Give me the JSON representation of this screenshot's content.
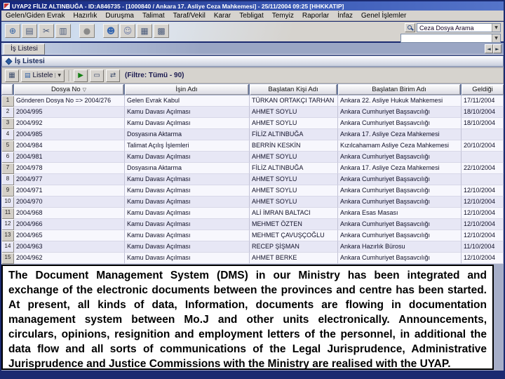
{
  "window": {
    "title": "UYAP2  FİLİZ ALTINBUĞA - ID:A846735 - [1000840 / Ankara 17. Asliye Ceza Mahkemesi] - 25/11/2004 09:25 [HHKKATIP]"
  },
  "menu": {
    "items": [
      {
        "label": "Gelen/Giden Evrak"
      },
      {
        "label": "Hazırlık"
      },
      {
        "label": "Duruşma"
      },
      {
        "label": "Talimat"
      },
      {
        "label": "Taraf/Vekil"
      },
      {
        "label": "Karar"
      },
      {
        "label": "Tebligat"
      },
      {
        "label": "Temyiz"
      },
      {
        "label": "Raporlar"
      },
      {
        "label": "İnfaz"
      },
      {
        "label": "Genel İşlemler"
      }
    ]
  },
  "toolbar": {
    "icons": [
      {
        "name": "globe-icon",
        "glyph": "⊕",
        "color": "#2e5fa3"
      },
      {
        "name": "copy-document-icon",
        "glyph": "▤",
        "color": "#4a5a7a"
      },
      {
        "name": "cut-icon",
        "glyph": "✂",
        "color": "#4a5a7a"
      },
      {
        "name": "paste-icon",
        "glyph": "▥",
        "color": "#4a5a7a"
      },
      {
        "name": "record-icon",
        "glyph": "●",
        "color": "#8a8a8a",
        "sep": true
      },
      {
        "name": "users-icon",
        "glyph": "☻",
        "color": "#3566b0",
        "sep": true
      },
      {
        "name": "add-user-icon",
        "glyph": "☺",
        "color": "#6a79a6"
      },
      {
        "name": "calculator-icon",
        "glyph": "▦",
        "color": "#4a5a7a"
      },
      {
        "name": "grid-icon",
        "glyph": "▩",
        "color": "#4a5a7a"
      }
    ],
    "case_search": {
      "value": "Ceza Dosya Arama"
    },
    "secondary_combo": {
      "value": ""
    }
  },
  "icons": {
    "combo_arrow": "▼",
    "nav_left": "◄",
    "nav_right": "►",
    "sort_desc": "▽",
    "grid": "▦",
    "list": "▤",
    "play": "▶",
    "note": "▭",
    "refresh": "⇄"
  },
  "tabs": {
    "worklist": "İş Listesi"
  },
  "frame": {
    "title": "İş Listesi"
  },
  "subtoolbar": {
    "listele": "Listele",
    "filter": "(Filtre: Tümü - 90)"
  },
  "table": {
    "headers": {
      "dosya_no": "Dosya No",
      "isin_adi": "İşin Adı",
      "kisi": "Başlatan Kişi Adı",
      "birim": "Başlatan Birim Adı",
      "geldigi": "Geldiği"
    },
    "rows": [
      {
        "num": "1",
        "dosya_no": "Gönderen Dosya No => 2004/276",
        "isin_adi": "Gelen Evrak Kabul",
        "kisi": "TÜRKAN ORTAKÇI TARHAN",
        "birim": "Ankara 22. Asliye Hukuk Mahkemesi",
        "geldigi": "17/11/2004"
      },
      {
        "num": "2",
        "dosya_no": "2004/995",
        "isin_adi": "Kamu Davası Açılması",
        "kisi": "AHMET SOYLU",
        "birim": "Ankara Cumhuriyet Başsavcılığı",
        "geldigi": "18/10/2004"
      },
      {
        "num": "3",
        "dosya_no": "2004/992",
        "isin_adi": "Kamu Davası Açılması",
        "kisi": "AHMET SOYLU",
        "birim": "Ankara Cumhuriyet Başsavcılığı",
        "geldigi": "18/10/2004"
      },
      {
        "num": "4",
        "dosya_no": "2004/985",
        "isin_adi": "Dosyasına Aktarma",
        "kisi": "FİLİZ ALTINBUĞA",
        "birim": "Ankara 17. Asliye Ceza Mahkemesi",
        "geldigi": ""
      },
      {
        "num": "5",
        "dosya_no": "2004/984",
        "isin_adi": "Talimat Açılış İşlemleri",
        "kisi": "BERRİN KESKİN",
        "birim": "Kızılcahamam Asliye Ceza Mahkemesi",
        "geldigi": "20/10/2004"
      },
      {
        "num": "6",
        "dosya_no": "2004/981",
        "isin_adi": "Kamu Davası Açılması",
        "kisi": "AHMET SOYLU",
        "birim": "Ankara Cumhuriyet Başsavcılığı",
        "geldigi": ""
      },
      {
        "num": "7",
        "dosya_no": "2004/978",
        "isin_adi": "Dosyasına Aktarma",
        "kisi": "FİLİZ ALTINBUĞA",
        "birim": "Ankara 17. Asliye Ceza Mahkemesi",
        "geldigi": "22/10/2004"
      },
      {
        "num": "8",
        "dosya_no": "2004/977",
        "isin_adi": "Kamu Davası Açılması",
        "kisi": "AHMET SOYLU",
        "birim": "Ankara Cumhuriyet Başsavcılığı",
        "geldigi": ""
      },
      {
        "num": "9",
        "dosya_no": "2004/971",
        "isin_adi": "Kamu Davası Açılması",
        "kisi": "AHMET SOYLU",
        "birim": "Ankara Cumhuriyet Başsavcılığı",
        "geldigi": "12/10/2004"
      },
      {
        "num": "10",
        "dosya_no": "2004/970",
        "isin_adi": "Kamu Davası Açılması",
        "kisi": "AHMET SOYLU",
        "birim": "Ankara Cumhuriyet Başsavcılığı",
        "geldigi": "12/10/2004"
      },
      {
        "num": "11",
        "dosya_no": "2004/968",
        "isin_adi": "Kamu Davası Açılması",
        "kisi": "ALİ İMRAN BALTACI",
        "birim": "Ankara Esas Masası",
        "geldigi": "12/10/2004"
      },
      {
        "num": "12",
        "dosya_no": "2004/966",
        "isin_adi": "Kamu Davası Açılması",
        "kisi": "MEHMET ÖZTEN",
        "birim": "Ankara Cumhuriyet Başsavcılığı",
        "geldigi": "12/10/2004"
      },
      {
        "num": "13",
        "dosya_no": "2004/965",
        "isin_adi": "Kamu Davası Açılması",
        "kisi": "MEHMET ÇAVUŞÇOĞLU",
        "birim": "Ankara Cumhuriyet Başsavcılığı",
        "geldigi": "12/10/2004"
      },
      {
        "num": "14",
        "dosya_no": "2004/963",
        "isin_adi": "Kamu Davası Açılması",
        "kisi": "RECEP ŞİŞMAN",
        "birim": "Ankara Hazırlık Bürosu",
        "geldigi": "11/10/2004"
      },
      {
        "num": "15",
        "dosya_no": "2004/962",
        "isin_adi": "Kamu Davası Açılması",
        "kisi": "AHMET BERKE",
        "birim": "Ankara Cumhuriyet Başsavcılığı",
        "geldigi": "12/10/2004"
      }
    ]
  },
  "overlay": {
    "text": "The Document Management System (DMS) in our Ministry has been integrated and exchange of the electronic documents between the provinces and centre has been started. At present, all kinds of data, Information, documents are flowing in documentation management system between Mo.J and other units electronically. Announcements, circulars, opinions, resignition and employment letters of the personnel, in additional the data flow and all sorts of communications of the Legal Jurisprudence, Administrative Jurisprudence and Justice Commissions with the Ministry are realised with the UYAP."
  },
  "colors": {
    "titlebar_blue": "#14257b",
    "background_navy": "#1b2a70",
    "row_alt": "#e7e7f5",
    "overlay_border": "#000000"
  }
}
